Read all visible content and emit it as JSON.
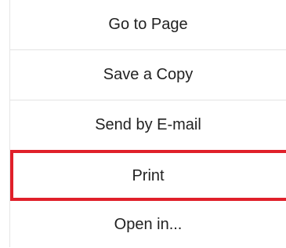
{
  "menu": {
    "items": [
      {
        "label": "Go to Page"
      },
      {
        "label": "Save a Copy"
      },
      {
        "label": "Send by E-mail"
      },
      {
        "label": "Print"
      },
      {
        "label": "Open in..."
      }
    ]
  },
  "colors": {
    "highlight": "#e0202a",
    "text": "#222222",
    "divider": "#e3e3e3",
    "background": "#ffffff"
  }
}
